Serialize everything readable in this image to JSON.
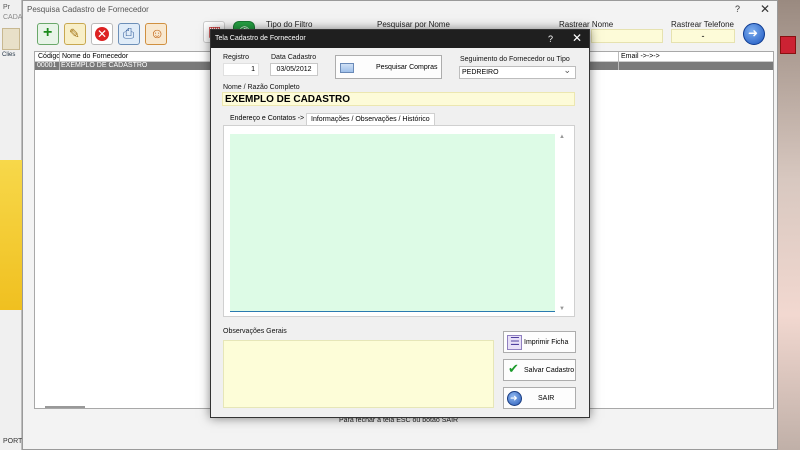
{
  "background": {
    "left_title": "Pr",
    "left_subtitle": "CADA",
    "left_icon_label": "Clies",
    "left_status": "PORT"
  },
  "main_window": {
    "title": "Pesquisa Cadastro de Fornecedor",
    "help_glyph": "?",
    "close_glyph": "✕",
    "filter_type_label": "Tipo do Filtro",
    "search_name_label": "Pesquisar por Nome",
    "track_name_label": "Rastrear Nome",
    "track_phone_label": "Rastrear Telefone",
    "track_phone_value": "-",
    "grid": {
      "columns": [
        "Código",
        "Nome do Fornecedor",
        "Email ->->->"
      ],
      "rows": [
        {
          "codigo": "00001",
          "nome": "EXEMPLO DE CADASTRO"
        }
      ]
    },
    "footer_hint": "Para fechar a tela ESC ou botão SAIR"
  },
  "dialog": {
    "title": "Tela Cadastro de Fornecedor",
    "help_glyph": "?",
    "close_glyph": "✕",
    "registro_label": "Registro",
    "registro_value": "1",
    "data_label": "Data Cadastro",
    "data_value": "03/05/2012",
    "pesquisar_compras_label": "Pesquisar Compras",
    "segmento_label": "Seguimento do Fornecedor ou Tipo",
    "segmento_value": "PEDREIRO",
    "nome_label": "Nome / Razão Completo",
    "nome_value": "EXEMPLO DE CADASTRO",
    "tabs": [
      {
        "label": "Endereço e Contatos ->"
      },
      {
        "label": "Informações / Observações / Histórico"
      }
    ],
    "obs_label": "Observações Gerais",
    "buttons": {
      "imprimir": "Imprimir Ficha",
      "salvar": "Salvar Cadastro",
      "sair": "SAIR"
    }
  }
}
